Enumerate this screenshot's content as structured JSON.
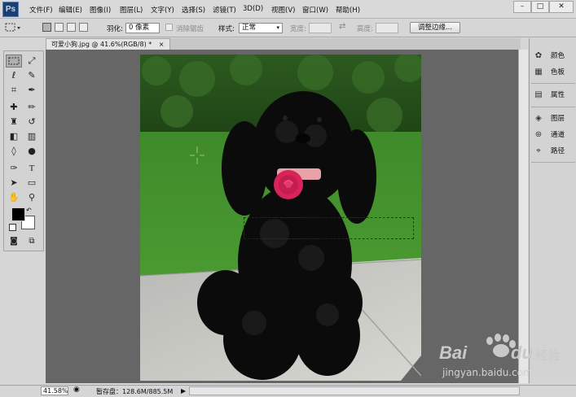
{
  "app": {
    "logo": "Ps"
  },
  "menu": [
    "文件(F)",
    "编辑(E)",
    "图像(I)",
    "图层(L)",
    "文字(Y)",
    "选择(S)",
    "滤镜(T)",
    "3D(D)",
    "视图(V)",
    "窗口(W)",
    "帮助(H)"
  ],
  "window_controls": {
    "minimize": "–",
    "maximize": "□",
    "close": "✕"
  },
  "options": {
    "feather_label": "羽化:",
    "feather_value": "0 像素",
    "antialias_label": "消除锯齿",
    "style_label": "样式:",
    "style_value": "正常",
    "width_label": "宽度:",
    "height_label": "高度:",
    "refine_edge": "调整边缘..."
  },
  "document": {
    "tab_title": "可爱小狗.jpg @ 41.6%(RGB/8) *",
    "tab_close": "×"
  },
  "right_panel": [
    {
      "icon": "palette-icon",
      "label": "颜色"
    },
    {
      "icon": "swatches-icon",
      "label": "色板"
    },
    {
      "icon": "properties-icon",
      "label": "属性"
    },
    {
      "icon": "layers-icon",
      "label": "图层"
    },
    {
      "icon": "channels-icon",
      "label": "通道"
    },
    {
      "icon": "paths-icon",
      "label": "路径"
    }
  ],
  "status": {
    "zoom": "41.58%",
    "scratch": "暂存盘：128.6M/885.5M"
  },
  "watermark": {
    "brand": "Bai",
    "brand2": "du",
    "chinese": "经验",
    "url": "jingyan.baidu.com"
  },
  "colors": {
    "accent": "#1c3f6e",
    "workspace": "#666666",
    "flower": "#d8245a",
    "grass": "#3f8a2a"
  }
}
